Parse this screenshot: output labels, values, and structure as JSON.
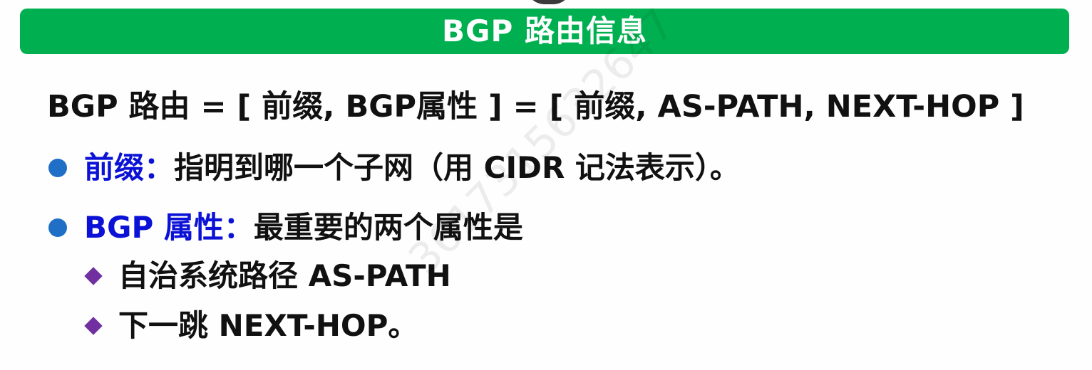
{
  "slide": {
    "title": "BGP 路由信息",
    "formula": "BGP 路由 = [ 前缀, BGP属性 ] = [ 前缀, AS-PATH, NEXT-HOP ]",
    "bullets": [
      {
        "term": "前缀：",
        "text": "指明到哪一个子网（用 CIDR 记法表示）。",
        "term_color": "#0b12d6"
      },
      {
        "term": "BGP 属性：",
        "text": "最重要的两个属性是",
        "term_color": "#0b12d6",
        "sub_items": [
          {
            "text": "自治系统路径 AS-PATH"
          },
          {
            "text": "下一跳 NEXT-HOP。"
          }
        ]
      }
    ]
  },
  "colors": {
    "title_bar": "#00b050",
    "bullet_dot": "#1f6fc6",
    "sub_bullet_diamond": "#7030a0"
  },
  "icons": {
    "bullet": "circle-bullet-icon",
    "sub_bullet": "diamond-bullet-icon"
  },
  "watermark": "3617315632647"
}
